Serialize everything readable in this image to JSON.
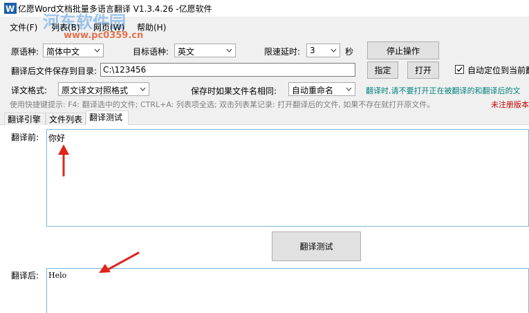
{
  "window": {
    "title": "亿愿Word文档批量多语言翻译 V1.3.4.26 -亿愿软件"
  },
  "watermark": {
    "text": "河东软件园",
    "url": "www.pc0359.cn"
  },
  "menu": [
    {
      "label": "文件(F)"
    },
    {
      "label": "列表(B)"
    },
    {
      "label": "网页(W)"
    },
    {
      "label": "帮助(H)"
    }
  ],
  "settings": {
    "source_label": "原语种:",
    "source_value": "简体中文",
    "target_label": "目标语种:",
    "target_value": "英文",
    "delay_label": "限速延时:",
    "delay_value": "3",
    "delay_unit": "秒",
    "stop_button": "停止操作",
    "save_dir_label": "翻译后文件保存到目录:",
    "save_dir_value": "C:\\123456",
    "assign_button": "指定",
    "open_button": "打开",
    "autolocate_label": "自动定位到当前翻",
    "autolocate_checked": true,
    "format_label": "译文格式:",
    "format_value": "原文译文对照格式",
    "samename_label": "保存时如果文件名相同:",
    "samename_value": "自动重命名",
    "warning_text": "翻译时,请不要打开正在被翻译的和翻译后的文",
    "hint_text": "使用快捷键提示: F4: 翻译选中的文件; CTRL+A: 列表项全选; 双击列表某记录: 打开翻译后的文件, 如果不存在就打开原文件。",
    "unregistered_text": "未注册版本"
  },
  "tabs": [
    {
      "label": "翻译引擎"
    },
    {
      "label": "文件列表"
    },
    {
      "label": "翻译测试"
    }
  ],
  "test": {
    "before_label": "翻译前:",
    "before_text": "你好",
    "translate_button": "翻译测试",
    "after_label": "翻译后:",
    "after_text": "Helo"
  },
  "colors": {
    "warning": "#00827f",
    "unregistered": "#c00000",
    "annotation_arrow": "#e0231b"
  }
}
